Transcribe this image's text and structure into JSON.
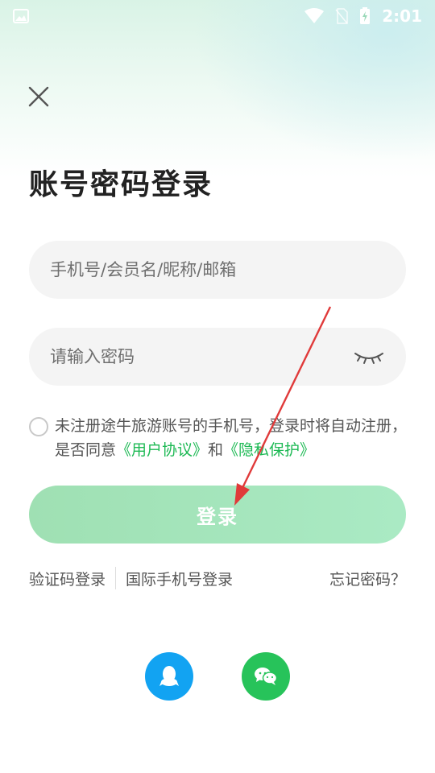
{
  "status_bar": {
    "time": "2:01"
  },
  "header": {
    "title": "账号密码登录"
  },
  "form": {
    "username_placeholder": "手机号/会员名/昵称/邮箱",
    "password_placeholder": "请输入密码"
  },
  "agreement": {
    "text_prefix": "未注册途牛旅游账号的手机号，登录时将自动注册，是否同意",
    "user_agreement": "《用户协议》",
    "and": "和",
    "privacy": "《隐私保护》"
  },
  "login_button": {
    "label": "登录"
  },
  "options": {
    "sms_login": "验证码登录",
    "intl_login": "国际手机号登录",
    "forgot": "忘记密码？"
  },
  "social": {
    "qq_icon": "qq-icon",
    "wechat_icon": "wechat-icon"
  },
  "colors": {
    "accent": "#1db954",
    "login_button": "#a3e4bb",
    "qq": "#12a3f2",
    "wechat": "#27c35a",
    "arrow": "#e03a3a"
  }
}
